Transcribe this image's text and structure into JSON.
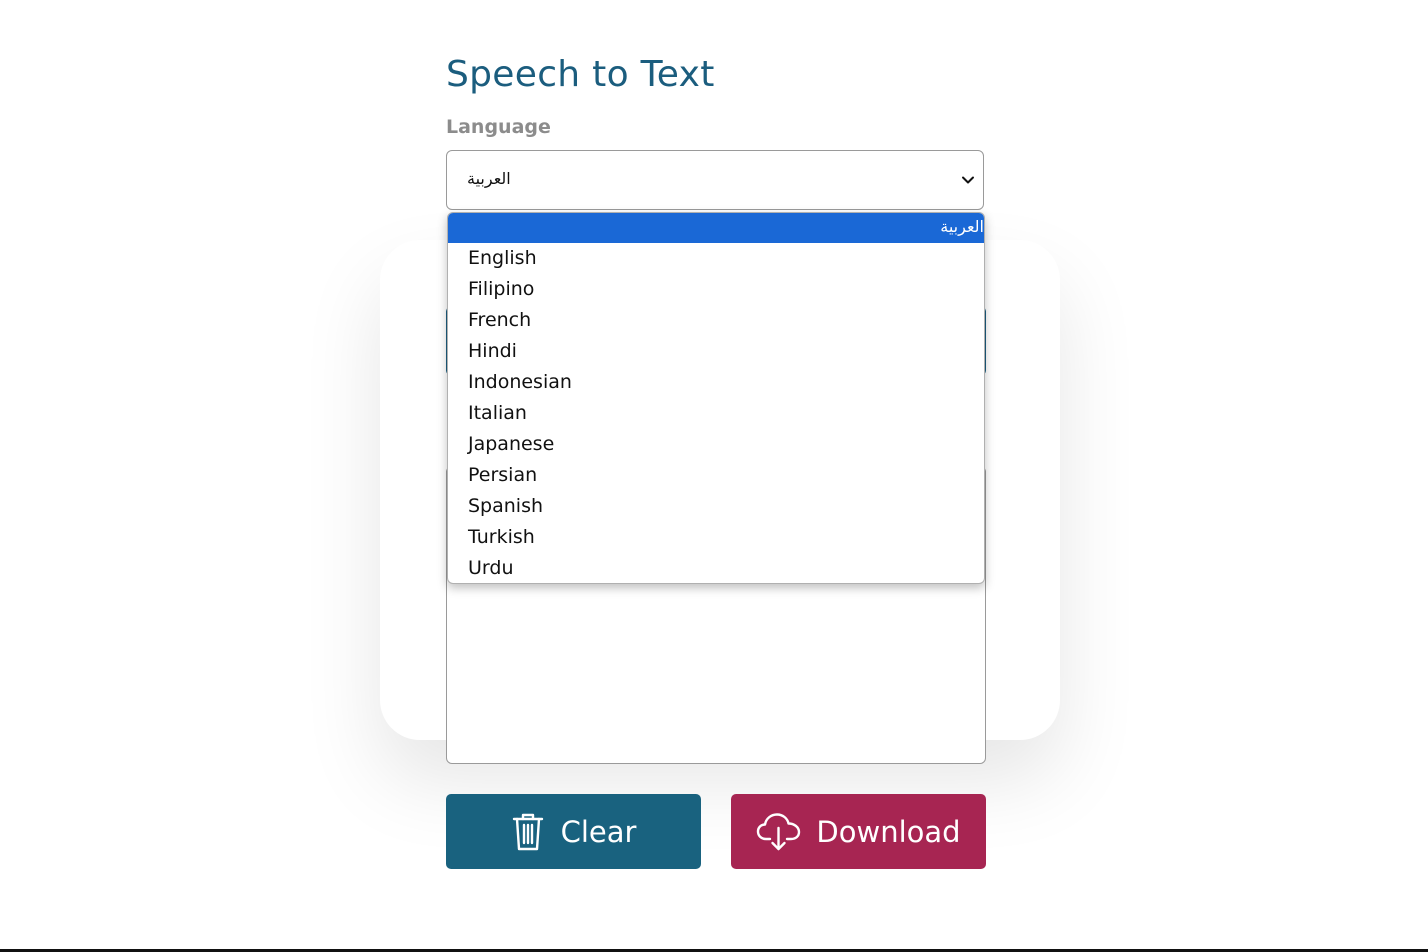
{
  "header": {
    "title": "Speech to Text"
  },
  "language": {
    "label": "Language",
    "selected": "العربية",
    "options": [
      "العربية",
      "English",
      "Filipino",
      "French",
      "Hindi",
      "Indonesian",
      "Italian",
      "Japanese",
      "Persian",
      "Spanish",
      "Turkish",
      "Urdu"
    ]
  },
  "actions": {
    "clear_label": "Clear",
    "download_label": "Download"
  },
  "icons": {
    "select": "chevron-down-icon",
    "clear": "trash-icon",
    "download": "cloud-download-icon"
  },
  "colors": {
    "title": "#1b5d7e",
    "clear_button": "#19627f",
    "download_button": "#a72552",
    "option_highlight": "#1a68d6"
  }
}
